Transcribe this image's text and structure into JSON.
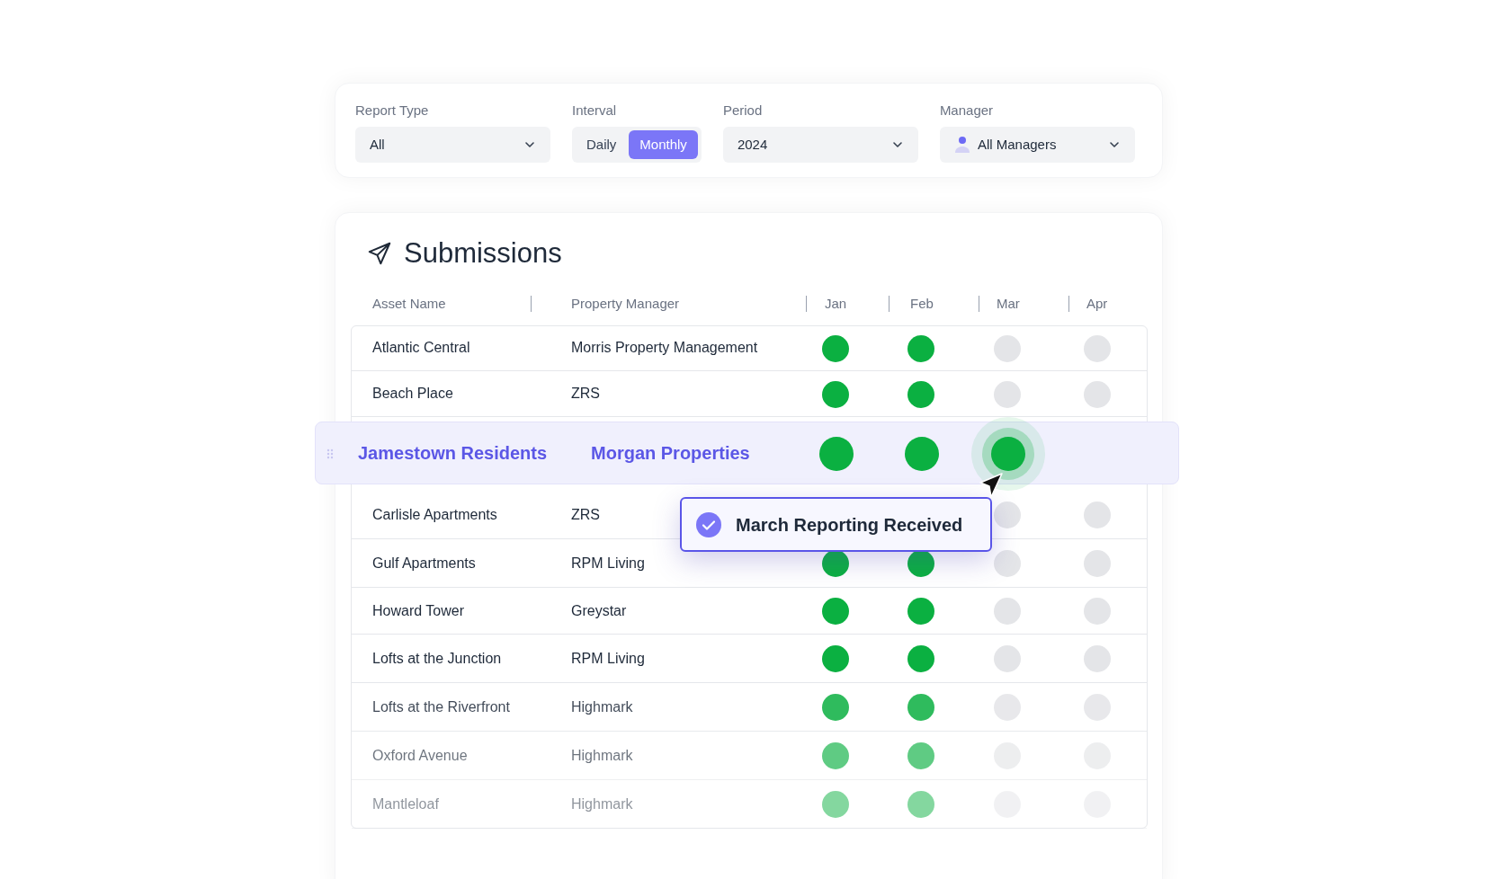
{
  "filters": [
    {
      "kind": "select",
      "label": "Report Type",
      "value": "All"
    },
    {
      "kind": "toggle",
      "label": "Interval",
      "options": [
        {
          "label": "Daily",
          "selected": false
        },
        {
          "label": "Monthly",
          "selected": true
        }
      ]
    },
    {
      "kind": "select",
      "label": "Period",
      "value": "2024"
    },
    {
      "kind": "select",
      "label": "Manager",
      "value": "All Managers",
      "avatar": true
    }
  ],
  "submissions": {
    "title": "Submissions",
    "columns": [
      "Asset Name",
      "Property Manager",
      "Jan",
      "Feb",
      "Mar",
      "Apr"
    ],
    "rows": [
      {
        "asset": "Atlantic Central",
        "manager": "Morris Property Management",
        "highlighted": false,
        "received": {
          "jan": true,
          "feb": true,
          "mar": false,
          "apr": false
        }
      },
      {
        "asset": "Beach Place",
        "manager": "ZRS",
        "highlighted": false,
        "received": {
          "jan": true,
          "feb": true,
          "mar": false,
          "apr": false
        }
      },
      {
        "asset": "Jamestown Residents",
        "manager": "Morgan Properties",
        "highlighted": true,
        "received": {
          "jan": true,
          "feb": true,
          "mar": true
        }
      },
      {
        "asset": "Carlisle Apartments",
        "manager": "ZRS",
        "highlighted": false,
        "received": {
          "mar": false,
          "apr": false
        }
      },
      {
        "asset": "Gulf Apartments",
        "manager": "RPM Living",
        "highlighted": false,
        "received": {
          "jan": true,
          "feb": true,
          "mar": false,
          "apr": false
        }
      },
      {
        "asset": "Howard Tower",
        "manager": "Greystar",
        "highlighted": false,
        "received": {
          "jan": true,
          "feb": true,
          "mar": false,
          "apr": false
        }
      },
      {
        "asset": "Lofts at the Junction",
        "manager": "RPM Living",
        "highlighted": false,
        "received": {
          "jan": true,
          "feb": true,
          "mar": false,
          "apr": false
        }
      },
      {
        "asset": "Lofts at the Riverfront",
        "manager": "Highmark",
        "highlighted": false,
        "received": {
          "jan": true,
          "feb": true,
          "mar": false,
          "apr": false
        }
      },
      {
        "asset": "Oxford Avenue",
        "manager": "Highmark",
        "highlighted": false,
        "received": {
          "jan": true,
          "feb": true,
          "mar": false,
          "apr": false
        }
      },
      {
        "asset": "Mantleloaf",
        "manager": "Highmark",
        "highlighted": false,
        "received": {
          "jan": true,
          "feb": true,
          "mar": false,
          "apr": false
        }
      }
    ]
  },
  "tooltip": {
    "text": "March Reporting Received"
  }
}
